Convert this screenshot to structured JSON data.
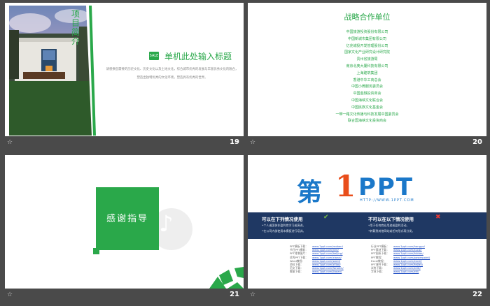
{
  "slides": {
    "s19": {
      "number": "19",
      "vertical_title": "项目简介",
      "tag": "SALE",
      "title": "单机此处输入标题",
      "body": "请替换您需要的历史文化、历史文化以及土地文化，综合城市优秀的发展与丰富优秀文化的融合，塑造出独特优秀的文化环境，塑造具有优秀的世界。"
    },
    "s20": {
      "number": "20",
      "title": "战略合作单位",
      "orgs": [
        "中国旅游投资股份有限公司",
        "中国新城市集团有限公司",
        "亿兆城投开发管理股份公司",
        "国家文化产业研究设计研究院",
        "贵州省旅游局",
        "南京北奥大厦科技有限公司",
        "上海建筑集团",
        "香港中华工商总会",
        "中国小微服务委员会",
        "中国金融投资商会",
        "中国海峡文化联合会",
        "中国民族文化基金会",
        "一带一路文化传播与科技发展中国委员会",
        "联合国海峡文化投资商会"
      ]
    },
    "s21": {
      "number": "21",
      "thanks": "感谢指导",
      "note_symbol": "♪"
    },
    "s22": {
      "number": "22",
      "logo_char": "第",
      "logo_one": "1",
      "logo_ppt": "PPT",
      "url": "HTTP://WWW.1PPT.COM",
      "can_use_title": "可以在下列情况使用",
      "can_use_lines": [
        "•个人或团体非盈利性学习或演讲。",
        "•在公司内部使用本模板进行培训。"
      ],
      "cannot_use_title": "不可以在以下情况使用",
      "cannot_use_lines": [
        "•用于任何商业用途或盈利活动。",
        "•转载到其他网站或任何形式再分发。"
      ],
      "check_symbol": "✔",
      "cross_symbol": "✖",
      "links_left": [
        {
          "k": "PPT模板下载：",
          "v": "www.1ppt.com/moban/"
        },
        {
          "k": "节日PPT模板：",
          "v": "www.1ppt.com/jieri/"
        },
        {
          "k": "PPT背景图片：",
          "v": "www.1ppt.com/beijing/"
        },
        {
          "k": "优秀PPT下载：",
          "v": "www.1ppt.com/xiazai/"
        },
        {
          "k": "Word教程：",
          "v": "www.1ppt.com/word/"
        },
        {
          "k": "资料下载：",
          "v": "www.1ppt.com/ziliao/"
        },
        {
          "k": "范文下载：",
          "v": "www.1ppt.com/fanwen/"
        },
        {
          "k": "教案下载：",
          "v": "www.1ppt.com/jiaoan/"
        }
      ],
      "links_right": [
        {
          "k": "行业PPT模板：",
          "v": "www.1ppt.com/hangye/"
        },
        {
          "k": "PPT素材下载：",
          "v": "www.1ppt.com/sucai/"
        },
        {
          "k": "PPT图表下载：",
          "v": "www.1ppt.com/tubiao/"
        },
        {
          "k": "PPT教程：",
          "v": "www.1ppt.com/powerpoint/"
        },
        {
          "k": "Excel教程：",
          "v": "www.1ppt.com/excel/"
        },
        {
          "k": "PPT课件下载：",
          "v": "www.1ppt.com/kejian/"
        },
        {
          "k": "试卷下载：",
          "v": "www.1ppt.com/shiti/"
        },
        {
          "k": "字体下载：",
          "v": "www.1ppt.com/ziti/"
        }
      ]
    }
  },
  "star_symbol": "☆",
  "colors": {
    "accent": "#2aa84a",
    "background": "#4a4a4a",
    "navy": "#1f3863",
    "logo_blue": "#1b78c9",
    "logo_orange": "#e94e1b"
  }
}
